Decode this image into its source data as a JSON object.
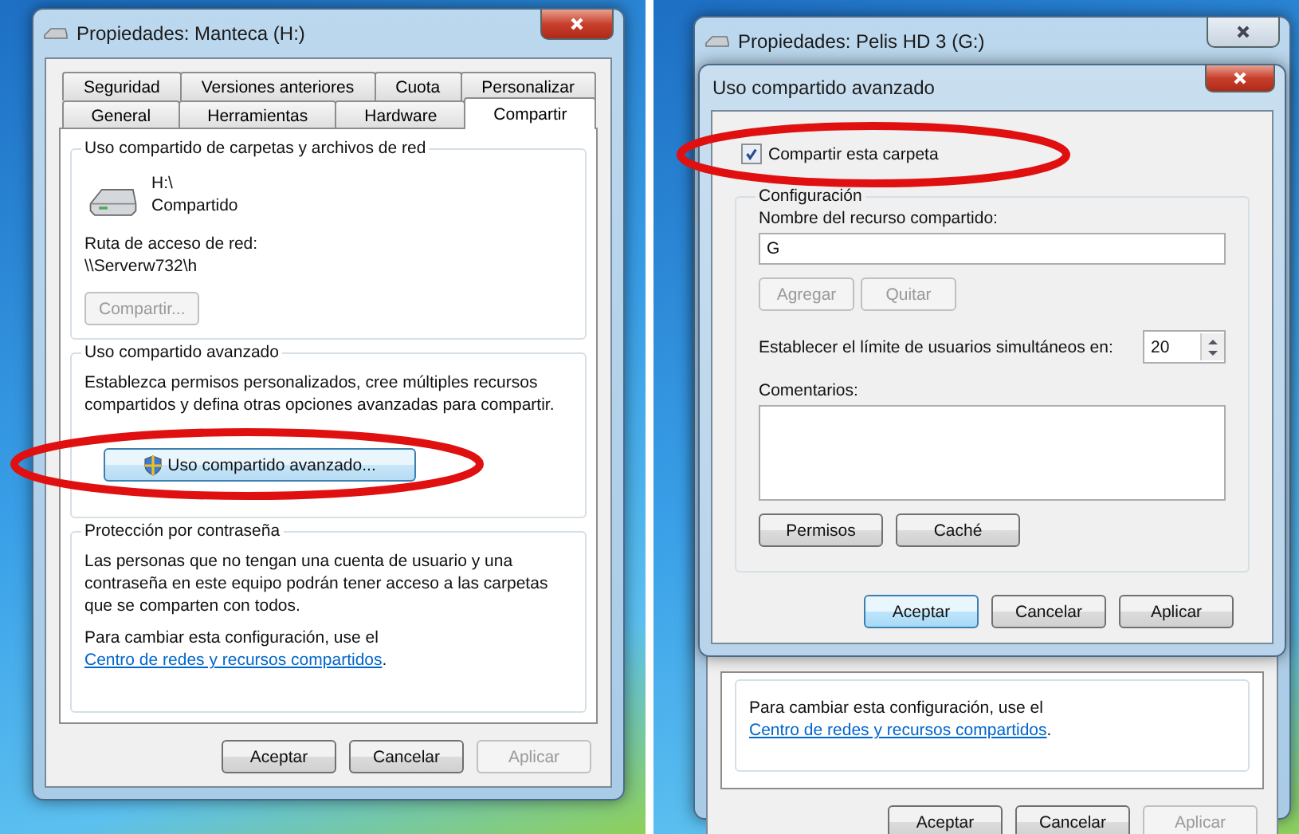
{
  "left_window": {
    "title": "Propiedades: Manteca (H:)",
    "tab_rows": [
      [
        {
          "label": "Seguridad",
          "selected": false
        },
        {
          "label": "Versiones anteriores",
          "selected": false
        },
        {
          "label": "Cuota",
          "selected": false
        },
        {
          "label": "Personalizar",
          "selected": false
        }
      ],
      [
        {
          "label": "General",
          "selected": false
        },
        {
          "label": "Herramientas",
          "selected": false
        },
        {
          "label": "Hardware",
          "selected": false
        },
        {
          "label": "Compartir",
          "selected": true
        }
      ]
    ],
    "network_group": {
      "title": "Uso compartido de carpetas y archivos de red",
      "drive_path": "H:\\",
      "drive_status": "Compartido",
      "path_label": "Ruta de acceso de red:",
      "path_value": "\\\\Serverw732\\h",
      "share_button": {
        "label": "Compartir...",
        "disabled": true
      }
    },
    "advanced_group": {
      "title": "Uso compartido avanzado",
      "description": "Establezca permisos personalizados, cree múltiples recursos compartidos y defina otras opciones avanzadas para compartir.",
      "button": {
        "label": "Uso compartido avanzado...",
        "disabled": false
      }
    },
    "password_group": {
      "title": "Protección por contraseña",
      "text": "Las personas que no tengan una cuenta de usuario y una contraseña en este equipo podrán tener acceso a las carpetas que se comparten con todos.",
      "note": "Para cambiar esta configuración, use el",
      "link": "Centro de redes y recursos compartidos",
      "note_end": "."
    },
    "buttons": [
      {
        "label": "Aceptar",
        "disabled": false,
        "default": false
      },
      {
        "label": "Cancelar",
        "disabled": false,
        "default": false
      },
      {
        "label": "Aplicar",
        "disabled": true,
        "default": false
      }
    ]
  },
  "right_window": {
    "title": "Propiedades: Pelis HD 3 (G:)",
    "note": "Para cambiar esta configuración, use el",
    "link": "Centro de redes y recursos compartidos",
    "note_end": ".",
    "buttons": [
      {
        "label": "Aceptar",
        "disabled": false,
        "default": false
      },
      {
        "label": "Cancelar",
        "disabled": false,
        "default": false
      },
      {
        "label": "Aplicar",
        "disabled": true,
        "default": false
      }
    ],
    "dialog": {
      "title": "Uso compartido avanzado",
      "share_checkbox": {
        "label": "Compartir esta carpeta",
        "checked": true
      },
      "group_title": "Configuración",
      "name_label": "Nombre del recurso compartido:",
      "name_value": "G",
      "name_buttons": [
        {
          "label": "Agregar",
          "disabled": true,
          "default": false
        },
        {
          "label": "Quitar",
          "disabled": true,
          "default": false
        }
      ],
      "limit_label": "Establecer el límite de usuarios simultáneos en:",
      "limit_value": "20",
      "comments_label": "Comentarios:",
      "group_buttons": [
        {
          "label": "Permisos",
          "disabled": false,
          "default": false
        },
        {
          "label": "Caché",
          "disabled": false,
          "default": false
        }
      ],
      "buttons": [
        {
          "label": "Aceptar",
          "disabled": false,
          "default": true
        },
        {
          "label": "Cancelar",
          "disabled": false,
          "default": false
        },
        {
          "label": "Aplicar",
          "disabled": false,
          "default": false
        }
      ]
    }
  }
}
